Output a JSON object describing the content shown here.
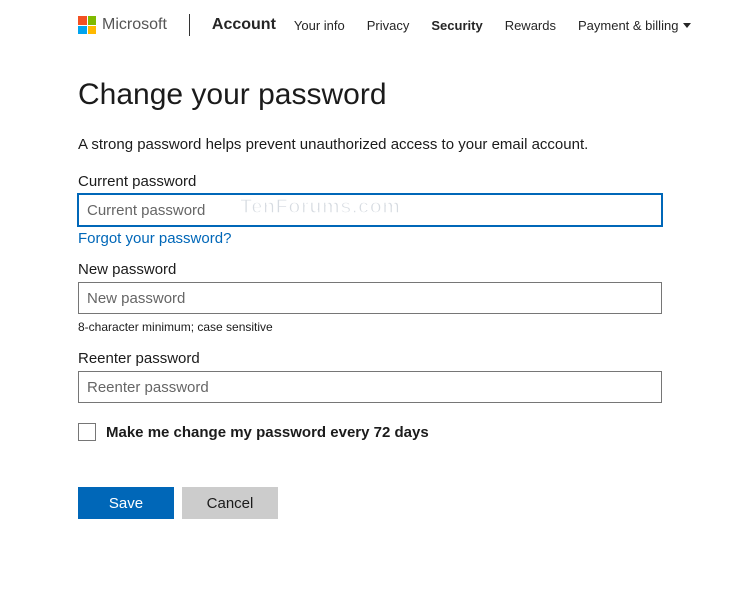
{
  "header": {
    "brand_text": "Microsoft",
    "product": "Account",
    "nav": [
      {
        "label": "Your info",
        "active": false
      },
      {
        "label": "Privacy",
        "active": false
      },
      {
        "label": "Security",
        "active": true
      },
      {
        "label": "Rewards",
        "active": false
      },
      {
        "label": "Payment & billing",
        "active": false,
        "chevron": true
      }
    ]
  },
  "page": {
    "title": "Change your password",
    "description": "A strong password helps prevent unauthorized access to your email account.",
    "current_password": {
      "label": "Current password",
      "placeholder": "Current password",
      "value": ""
    },
    "forgot_link": "Forgot your password?",
    "new_password": {
      "label": "New password",
      "placeholder": "New password",
      "value": "",
      "hint": "8-character minimum; case sensitive"
    },
    "reenter_password": {
      "label": "Reenter password",
      "placeholder": "Reenter password",
      "value": ""
    },
    "checkbox": {
      "label": "Make me change my password every 72 days",
      "checked": false
    },
    "buttons": {
      "save": "Save",
      "cancel": "Cancel"
    }
  },
  "watermark": "TenForums.com"
}
